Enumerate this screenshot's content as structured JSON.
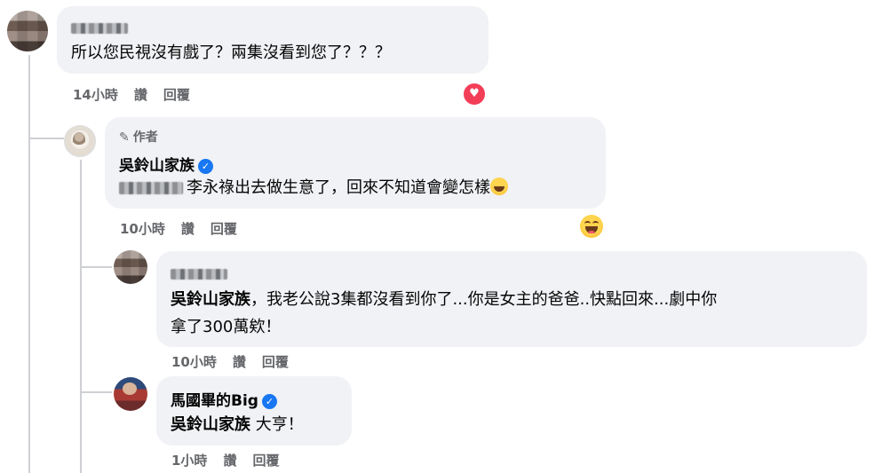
{
  "comment1": {
    "text": "所以您民視沒有戲了？兩集沒看到您了？？？",
    "time": "14小時",
    "like": "讚",
    "reply": "回覆",
    "reaction": "heart-reaction"
  },
  "comment2": {
    "author_badge": "作者",
    "author": "吳鈴山家族",
    "text": "李永祿出去做生意了，回來不知道會變怎樣",
    "time": "10小時",
    "like": "讚",
    "reply": "回覆",
    "reaction": "haha-reaction"
  },
  "comment3": {
    "mention": "吳鈴山家族",
    "text_line1": "，我老公說3集都沒看到你了...你是女主的爸爸..快點回來...劇中你",
    "text_line2": "拿了300萬欸！",
    "time": "10小時",
    "like": "讚",
    "reply": "回覆"
  },
  "comment4": {
    "author": "馬國畢的Big",
    "mention": "吳鈴山家族",
    "text": "大亨！",
    "time": "1小時",
    "like": "讚",
    "reply": "回覆"
  },
  "colors": {
    "bubble": "#f0f2f5",
    "secondary_text": "#65676b",
    "verified": "#1877f2",
    "heart": "#f33e58",
    "thread_line": "#ced0d4"
  }
}
